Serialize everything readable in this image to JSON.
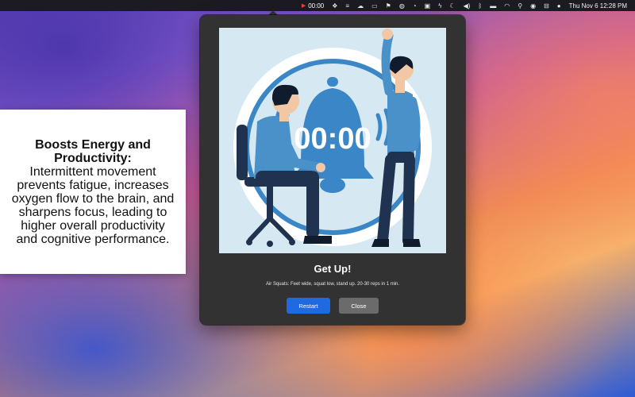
{
  "menubar": {
    "timer_value": "00:00",
    "clock": "Thu Nov 6  12:28 PM",
    "icons": [
      "dropbox-icon",
      "bars-icon",
      "cloud-icon",
      "monitor-icon",
      "flag-icon",
      "globe-icon",
      "timer-icon",
      "square-icon",
      "bolt-icon",
      "moon-icon",
      "volume-icon",
      "bluetooth-icon",
      "battery-icon",
      "wifi-icon",
      "search-icon",
      "user-icon",
      "control-center-icon",
      "siri-icon"
    ]
  },
  "popover": {
    "illustration": {
      "timer_display": "00:00",
      "colors": {
        "background": "#d6e9f3",
        "accent": "#3b86c6",
        "shirt": "#4a90c9",
        "pants": "#1f3350"
      }
    },
    "title": "Get Up!",
    "description": "Air Squats: Feet wide, squat low, stand up. 20-30 reps in 1 min.",
    "restart_label": "Restart",
    "close_label": "Close"
  },
  "info_card": {
    "heading": "Boosts Energy and Productivity:",
    "body": "Intermittent movement prevents fatigue, increases oxygen flow to the brain, and sharpens focus, leading to higher overall productivity and cognitive performance."
  }
}
